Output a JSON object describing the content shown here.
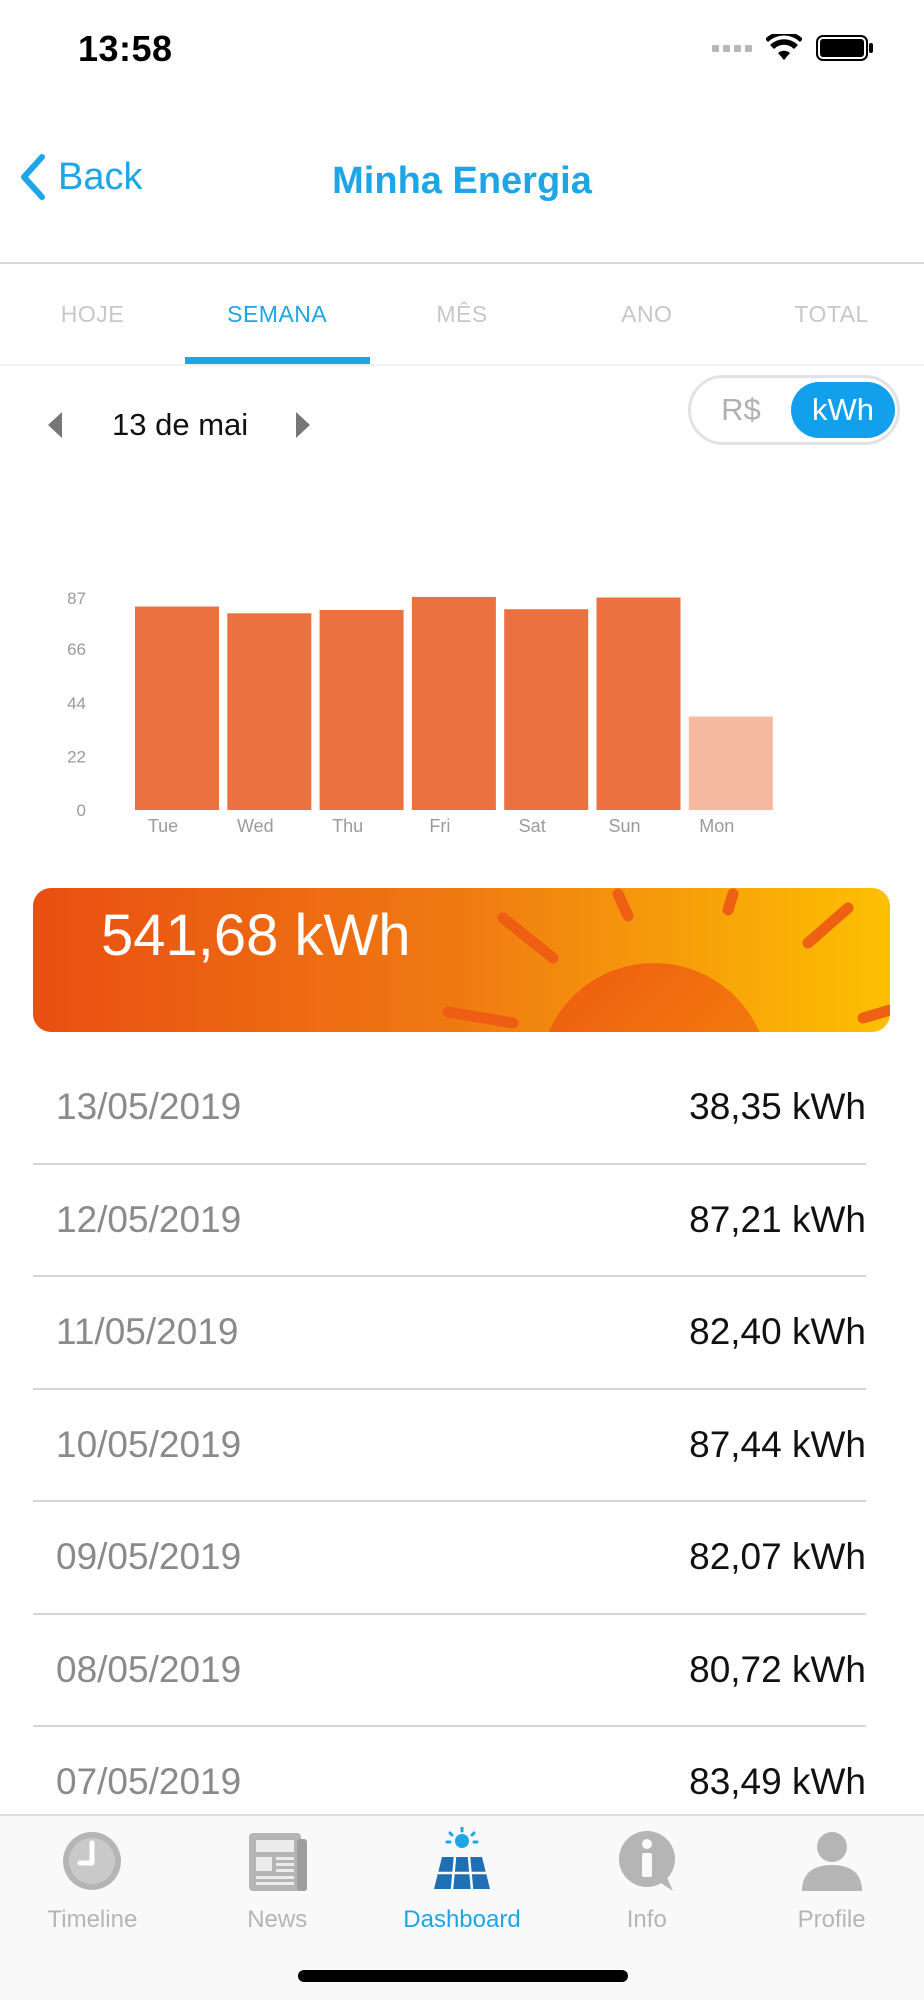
{
  "status_bar": {
    "time": "13:58"
  },
  "nav": {
    "back_label": "Back",
    "title": "Minha Energia"
  },
  "period_tabs": [
    {
      "label": "HOJE",
      "active": false
    },
    {
      "label": "SEMANA",
      "active": true
    },
    {
      "label": "MÊS",
      "active": false
    },
    {
      "label": "ANO",
      "active": false
    },
    {
      "label": "TOTAL",
      "active": false
    }
  ],
  "week_nav": {
    "label": "13 de mai"
  },
  "unit_toggle": {
    "options": [
      "R$",
      "kWh"
    ],
    "selected": "kWh"
  },
  "colors": {
    "accent": "#1ea5e6",
    "bar": "#ec7140",
    "bar_current": "#f5b8a0",
    "banner_start": "#e94f12",
    "banner_end": "#fdc002"
  },
  "chart_data": {
    "type": "bar",
    "categories": [
      "Tue",
      "Wed",
      "Thu",
      "Fri",
      "Sat",
      "Sun",
      "Mon"
    ],
    "values": [
      83.49,
      80.72,
      82.07,
      87.44,
      82.4,
      87.21,
      38.35
    ],
    "y_ticks": [
      0,
      22,
      44,
      66,
      87
    ],
    "ylim": [
      0,
      87
    ],
    "highlight_last": true,
    "grid": false,
    "legend": false
  },
  "total": {
    "value": "541,68 kWh"
  },
  "readings": [
    {
      "date": "13/05/2019",
      "value": "38,35 kWh"
    },
    {
      "date": "12/05/2019",
      "value": "87,21 kWh"
    },
    {
      "date": "11/05/2019",
      "value": "82,40 kWh"
    },
    {
      "date": "10/05/2019",
      "value": "87,44 kWh"
    },
    {
      "date": "09/05/2019",
      "value": "82,07 kWh"
    },
    {
      "date": "08/05/2019",
      "value": "80,72 kWh"
    },
    {
      "date": "07/05/2019",
      "value": "83,49 kWh"
    }
  ],
  "tab_bar": [
    {
      "label": "Timeline",
      "icon": "clock-icon",
      "active": false
    },
    {
      "label": "News",
      "icon": "newspaper-icon",
      "active": false
    },
    {
      "label": "Dashboard",
      "icon": "solar-panel-icon",
      "active": true
    },
    {
      "label": "Info",
      "icon": "info-bubble-icon",
      "active": false
    },
    {
      "label": "Profile",
      "icon": "person-icon",
      "active": false
    }
  ]
}
